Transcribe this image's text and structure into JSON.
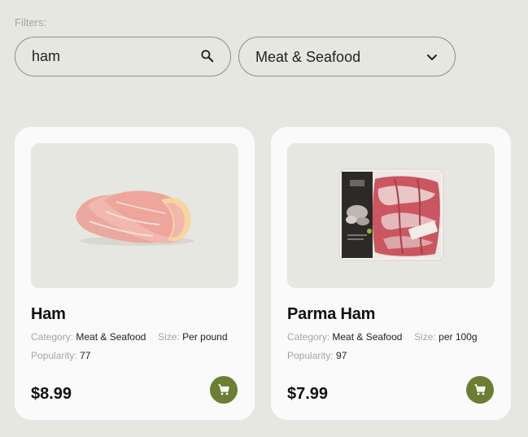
{
  "filters": {
    "label": "Filters:",
    "search": {
      "value": "ham",
      "icon": "search-icon"
    },
    "category": {
      "selected": "Meat & Seafood",
      "icon": "chevron-down-icon"
    }
  },
  "products": [
    {
      "name": "Ham",
      "category_label": "Category:",
      "category": "Meat & Seafood",
      "size_label": "Size:",
      "size": "Per pound",
      "popularity_label": "Popularity:",
      "popularity": "77",
      "price": "$8.99",
      "cart_icon": "cart-icon"
    },
    {
      "name": "Parma Ham",
      "category_label": "Category:",
      "category": "Meat & Seafood",
      "size_label": "Size:",
      "size": "per 100g",
      "popularity_label": "Popularity:",
      "popularity": "97",
      "price": "$7.99",
      "cart_icon": "cart-icon"
    }
  ],
  "colors": {
    "background": "#e7e7e1",
    "card": "#fafafa",
    "accent": "#6b7e33"
  }
}
